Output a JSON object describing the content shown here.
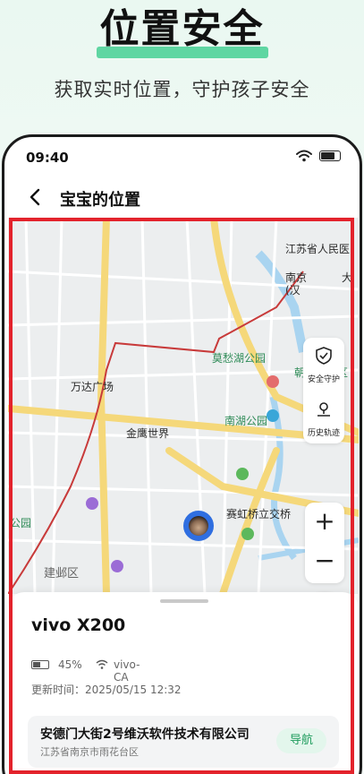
{
  "promo": {
    "title": "位置安全",
    "subtitle": "获取实时位置，守护孩子安全"
  },
  "status_bar": {
    "time": "09:40"
  },
  "nav": {
    "title": "宝宝的位置"
  },
  "map": {
    "pois": {
      "hospital": "江苏省人民医",
      "nanjing_partial": "南京",
      "han_partial": "(汉",
      "da_partial": "大",
      "moshou_park": "莫愁湖公园",
      "chaotian": "朝天宫景区",
      "wanda": "万达广场",
      "nanhu_park": "南湖公园",
      "jinying": "金鹰世界",
      "saihong": "赛虹桥立交桥",
      "park_left": "公园",
      "jianye": "建邺区"
    },
    "controls": {
      "safety_label": "安全守护",
      "track_label": "历史轨迹",
      "zoom_in": "+",
      "zoom_out": "−"
    }
  },
  "device": {
    "name": "vivo X200",
    "battery": "45%",
    "wifi": "vivo-CA",
    "update_time": "更新时间：2025/05/15 12:32"
  },
  "address": {
    "main": "安德门大街2号维沃软件技术有限公司",
    "sub": "江苏省南京市雨花台区",
    "nav_button": "导航"
  },
  "colors": {
    "accent_green": "#5fd6a2",
    "annotation_red": "#e3232c",
    "route_red": "#c83a3a"
  }
}
